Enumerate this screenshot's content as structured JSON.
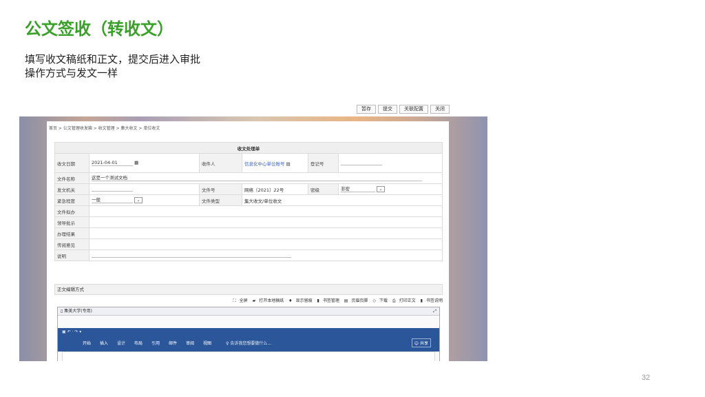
{
  "slide": {
    "title": "公文签收（转收文）",
    "desc1": "填写收文稿纸和正文，提交后进入审批",
    "desc2": "操作方式与发文一样",
    "page_number": "32"
  },
  "toolbar": {
    "save": "暂存",
    "submit": "提交",
    "related": "关联配置",
    "close": "关闭"
  },
  "breadcrumb": "首页 > 公文管理收发箱 > 收文管理 > 集大收文 > 单位收文",
  "form": {
    "title": "收文处理单",
    "receive_date_label": "收文日期",
    "receive_date": "2021-04-01",
    "recipient_label": "收件人",
    "recipient": "信息化中心单位账号",
    "reg_no_label": "登记号",
    "file_name_label": "文件名称",
    "file_name": "这是一个测试文档",
    "issuer_label": "发文机关",
    "doc_no_label": "文件号",
    "doc_no": "网络〔2021〕22号",
    "secret_label": "密级",
    "secret": "非密",
    "urgency_label": "紧急程度",
    "urgency": "一般",
    "doc_type_label": "文件类型",
    "doc_type": "集大收文/单位收文",
    "draft_label": "文件拟办",
    "leader_label": "领导批示",
    "result_label": "办理结果",
    "circulate_label": "传阅意见",
    "note_label": "说明"
  },
  "editor": {
    "mode_label": "正文编辑方式",
    "tools": [
      "全屏",
      "打开本地稿纸",
      "显示留痕",
      "书签管理",
      "页眉页脚",
      "下载",
      "打印正文",
      "书签说明"
    ],
    "doc_title": "集美大学(专用)",
    "ribbon_tabs": [
      "开始",
      "插入",
      "设计",
      "布局",
      "引用",
      "邮件",
      "审阅",
      "视图"
    ],
    "tell_me": "告诉我您想要做什么...",
    "share": "共享"
  }
}
